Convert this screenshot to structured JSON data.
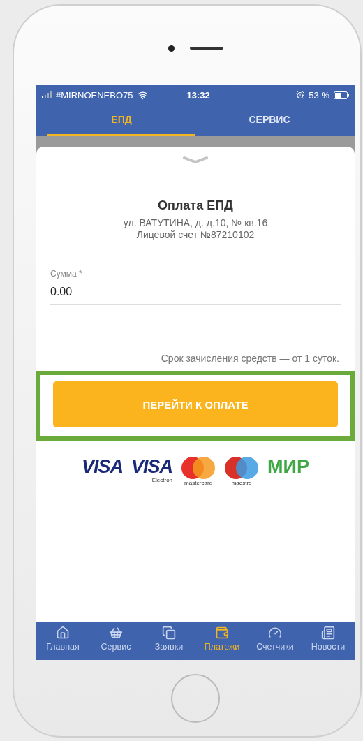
{
  "status_bar": {
    "carrier": "#MIRNOENEBO75",
    "time": "13:32",
    "battery": "53 %"
  },
  "tabs": [
    {
      "label": "ЕПД",
      "selected": true
    },
    {
      "label": "СЕРВИС",
      "selected": false
    }
  ],
  "payment": {
    "title": "Оплата ЕПД",
    "address": "ул. ВАТУТИНА, д. д.10, № кв.16",
    "account": "Лицевой счет №87210102",
    "amount_field": {
      "label": "Сумма *",
      "value": "0.00"
    },
    "note": "Срок зачисления средств — от 1 суток.",
    "pay_button": {
      "label": "ПЕРЕЙТИ К ОПЛАТЕ",
      "highlighted": true
    },
    "card_logos": [
      {
        "kind": "visa",
        "text": "VISA"
      },
      {
        "kind": "visa-electron",
        "text": "VISA",
        "subtext": "Electron"
      },
      {
        "kind": "mastercard",
        "subtext": "mastercard"
      },
      {
        "kind": "maestro",
        "subtext": "maestro"
      },
      {
        "kind": "mir",
        "text": "МИР"
      }
    ]
  },
  "bottom_nav": [
    {
      "kind": "home",
      "label": "Главная",
      "selected": false
    },
    {
      "kind": "basket",
      "label": "Сервис",
      "selected": false
    },
    {
      "kind": "docs",
      "label": "Заявки",
      "selected": false
    },
    {
      "kind": "wallet",
      "label": "Платежи",
      "selected": true
    },
    {
      "kind": "meter",
      "label": "Счетчики",
      "selected": false
    },
    {
      "kind": "news",
      "label": "Новости",
      "selected": false
    }
  ]
}
